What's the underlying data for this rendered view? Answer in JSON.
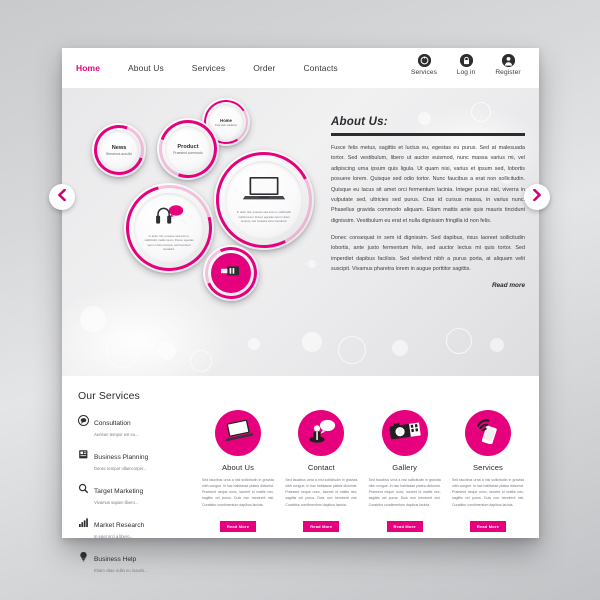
{
  "theme": {
    "accent": "#e6007e",
    "dark": "#2c2c2e",
    "page_bg": "#ffffff"
  },
  "header": {
    "nav": [
      {
        "label": "Home",
        "active": true
      },
      {
        "label": "About Us",
        "active": false
      },
      {
        "label": "Services",
        "active": false
      },
      {
        "label": "Order",
        "active": false
      },
      {
        "label": "Contacts",
        "active": false
      }
    ],
    "utils": [
      {
        "label": "Services",
        "icon": "info-circle-icon"
      },
      {
        "label": "Log in",
        "icon": "lock-icon"
      },
      {
        "label": "Register",
        "icon": "user-icon"
      }
    ]
  },
  "hero": {
    "prev_label": "‹",
    "next_label": "›",
    "circles": [
      {
        "id": "home",
        "title": "Home",
        "sub": "Free web solutions"
      },
      {
        "id": "news",
        "title": "News",
        "sub": "Streamos accu3x"
      },
      {
        "id": "product",
        "title": "Product",
        "sub": "Praesent commodo"
      },
      {
        "id": "laptop",
        "title": "",
        "sub": "",
        "body": "In dolor nisl, posuere sed erat ut, sollicitudin mattis lorem. Donec egestas sem in dolor tempus, sed molestie tortor hendrerit."
      },
      {
        "id": "audio",
        "title": "",
        "sub": "",
        "body": "In dolor nisl, posuere sed erat ut, sollicitudin mattis lorem. Donec egestas sem in dolor tempus, sed hendrerit standard."
      },
      {
        "id": "usb",
        "title": "",
        "sub": ""
      }
    ],
    "about": {
      "title": "About Us:",
      "paragraph1": "Fusce felis metus, sagittis et luctus eu, egestas eu purus. Sed at malesuada tortor. Sed vestibulum, libero ut auctor euismod, nunc massa varius mi, vel adipiscing urna ipsum quis ligula. Ut quam nisi, varius et ipsum sed, lobortis posuere lorem. Quisque sed odio tortor. Nunc faucibus a erat non sollicitudin. Quisque eu lacus sit amet orci fermentum lacinia. Integer purus nisl, viverra in vulputate sed, ultricies sed purus. Cras id cursus massa, in varius nunc. Phasellus gravida commodo aliquam. Etiam mattis ante quis mauris tincidunt dignissim. Vestibulum eu erat et nulla dignissim fringilla id non felis.",
      "paragraph2": "Donec consequat in sem id dignissim. Sed dapibus, risus laoreet sollicitudin lobortis, ante justo fermentum felis, sed auctor lectus mi quis tortor. Sed imperdiet dapibus facilisis. Sed eleifend nibh a purus porta, at aliquam velit suscipit. Vivamus pharetra lorem in augue porttitor sagittis.",
      "read_more": "Read more"
    }
  },
  "services": {
    "title": "Our Services",
    "list": [
      {
        "name": "Consultation",
        "sub": "Aenean tempor est eu...",
        "icon": "chat-bubble-icon"
      },
      {
        "name": "Business Planning",
        "sub": "Donec tempor ullamcorper...",
        "icon": "book-icon"
      },
      {
        "name": "Target Marketing",
        "sub": "Vivamus sapien libero...",
        "icon": "search-icon"
      },
      {
        "name": "Market Research",
        "sub": "In eget orci a libero...",
        "icon": "bar-chart-icon"
      },
      {
        "name": "Business Help",
        "sub": "Etiam vitae nulla eu mauris...",
        "icon": "lightbulb-icon"
      }
    ],
    "cards": [
      {
        "heading": "About Us",
        "icon": "laptop-icon",
        "body": "Sed faucibus urna a nisl sollicitudin in gravida nibh congue. In hac habitasse platea dictumst. Praesent neque nunc, laoreet id mattis nec, sagittis vel purus. Duis non hendrerit nisl. Curabitur condimentum dapibus lacinia.",
        "button": "Read More"
      },
      {
        "heading": "Contact",
        "icon": "support-chat-icon",
        "body": "Sed faucibus urna a nisl sollicitudin in gravida nibh congue. In hac habitasse platea dictumst. Praesent neque nunc, laoreet id mattis nec, sagittis vel purus. Duis non hendrerit nisl. Curabitur condimentum dapibus lacinia.",
        "button": "Read More"
      },
      {
        "heading": "Gallery",
        "icon": "camera-icon",
        "body": "Sed faucibus urna a nisl sollicitudin in gravida nibh congue. In hac habitasse platea dictumst. Praesent neque nunc, laoreet id mattis nec, sagittis vel purus. Duis non hendrerit nisl. Curabitur condimentum dapibus lacinia.",
        "button": "Read More"
      },
      {
        "heading": "Services",
        "icon": "wifi-signal-icon",
        "body": "Sed faucibus urna a nisl sollicitudin in gravida nibh congue. In hac habitasse platea dictumst. Praesent neque nunc, laoreet id mattis nec, sagittis vel purus. Duis non hendrerit nisl. Curabitur condimentum dapibus lacinia.",
        "button": "Read More"
      }
    ]
  }
}
